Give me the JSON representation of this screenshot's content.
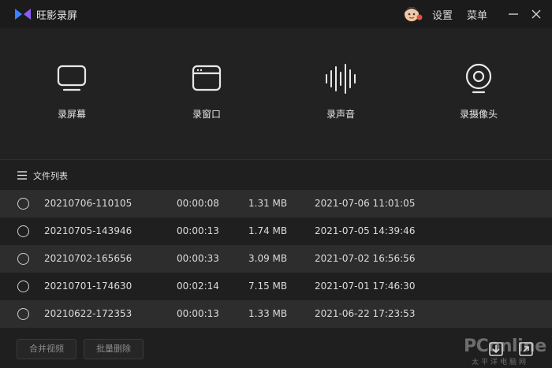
{
  "app": {
    "title": "旺影录屏"
  },
  "titlebar": {
    "settings": "设置",
    "menu": "菜单"
  },
  "tools": [
    {
      "label": "录屏幕",
      "icon": "monitor-icon"
    },
    {
      "label": "录窗口",
      "icon": "window-icon"
    },
    {
      "label": "录声音",
      "icon": "soundwave-icon"
    },
    {
      "label": "录摄像头",
      "icon": "webcam-icon"
    }
  ],
  "list": {
    "title": "文件列表",
    "rows": [
      {
        "name": "20210706-110105",
        "duration": "00:00:08",
        "size": "1.31 MB",
        "date": "2021-07-06 11:01:05"
      },
      {
        "name": "20210705-143946",
        "duration": "00:00:13",
        "size": "1.74 MB",
        "date": "2021-07-05 14:39:46"
      },
      {
        "name": "20210702-165656",
        "duration": "00:00:33",
        "size": "3.09 MB",
        "date": "2021-07-02 16:56:56"
      },
      {
        "name": "20210701-174630",
        "duration": "00:02:14",
        "size": "7.15 MB",
        "date": "2021-07-01 17:46:30"
      },
      {
        "name": "20210622-172353",
        "duration": "00:00:13",
        "size": "1.33 MB",
        "date": "2021-06-22 17:23:53"
      }
    ]
  },
  "bottom": {
    "merge": "合并视频",
    "batch_delete": "批量删除"
  },
  "watermark": {
    "brand": "PConline",
    "sub": "太平洋电脑网"
  },
  "colors": {
    "accent_logo": "#5a6bff",
    "background": "#1f1f1f",
    "row_alt": "#2d2d2d"
  }
}
